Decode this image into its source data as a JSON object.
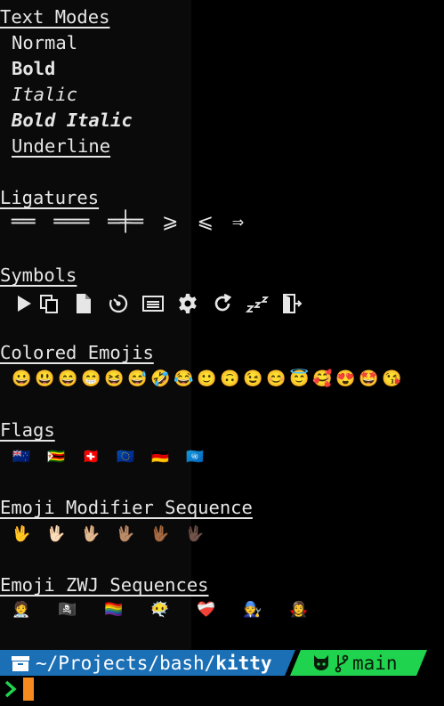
{
  "sections": {
    "text_modes": {
      "title": "Text Modes",
      "normal": "Normal",
      "bold": "Bold",
      "italic": "Italic",
      "bold_italic": "Bold Italic",
      "underline": "Underline"
    },
    "ligatures": {
      "title": "Ligatures",
      "items": [
        "══",
        "═══",
        "═╪═",
        "⩾",
        "⩽",
        "⇒"
      ]
    },
    "symbols": {
      "title": "Symbols",
      "icons": [
        "play-icon",
        "copy-icon",
        "document-icon",
        "timer-icon",
        "terminal-window-icon",
        "gear-icon",
        "refresh-icon",
        "sleep-icon",
        "exit-icon"
      ]
    },
    "colored_emojis": {
      "title": "Colored Emojis",
      "items": [
        "😀",
        "😃",
        "😄",
        "😁",
        "😆",
        "😅",
        "🤣",
        "😂",
        "🙂",
        "🙃",
        "😉",
        "😊",
        "😇",
        "🥰",
        "😍",
        "🤩",
        "😘"
      ]
    },
    "flags": {
      "title": "Flags",
      "items": [
        "🇳🇿",
        "🇿🇼",
        "🇨🇭",
        "🇪🇺",
        "🇩🇪",
        "🇺🇳"
      ]
    },
    "emoji_modifier": {
      "title": "Emoji Modifier Sequence",
      "items": [
        "🖖",
        "🖖🏻",
        "🖖🏼",
        "🖖🏽",
        "🖖🏾",
        "🖖🏿"
      ]
    },
    "emoji_zwj": {
      "title": "Emoji ZWJ Sequences",
      "items": [
        "🧑‍⚕️",
        "🏴‍☠️",
        "🏳️‍🌈",
        "😶‍🌫️",
        "❤️‍🩹",
        "🧑‍🔧",
        "🧛‍♀️"
      ]
    }
  },
  "prompt": {
    "path_prefix": "~/Projects/bash/",
    "path_current": "kitty",
    "branch": "main",
    "colors": {
      "path_bg": "#1b6fb5",
      "git_bg": "#1fd34e",
      "chevron": "#1fd34e",
      "cursor": "#f58a1f"
    }
  }
}
